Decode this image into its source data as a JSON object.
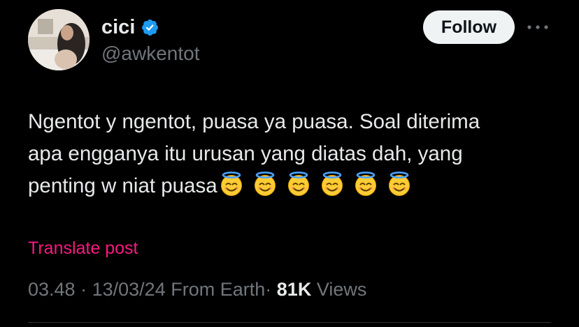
{
  "author": {
    "display_name": "cici",
    "handle": "@awkentot",
    "verified": true
  },
  "actions": {
    "follow_label": "Follow",
    "more_icon": "more-horizontal-icon"
  },
  "post": {
    "lines": [
      "Ngentot y ngentot, puasa ya puasa. Soal diterima",
      "apa engganya itu urusan yang diatas dah, yang",
      "penting w niat puasa"
    ],
    "emoji_name": "smiling-face-with-halo",
    "emoji_count": 6
  },
  "translate_label": "Translate post",
  "meta": {
    "time": "03.48",
    "separator": "·",
    "date": "13/03/24",
    "source": "From Earth",
    "views_count": "81K",
    "views_label": "Views"
  },
  "colors": {
    "background": "#000000",
    "text_primary": "#e7e9ea",
    "text_secondary": "#71767b",
    "verified_blue": "#1d9bf0",
    "translate_pink": "#f91880",
    "follow_button_bg": "#eff3f4"
  }
}
